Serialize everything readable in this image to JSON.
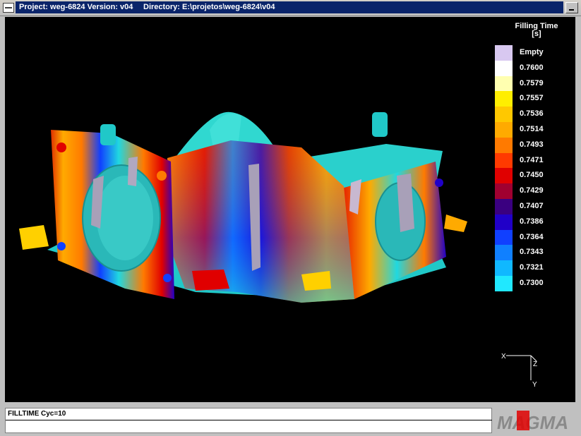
{
  "window": {
    "project_text": "Project: weg-6824  Version: v04",
    "directory_text": "Directory: E:\\projetos\\weg-6824\\v04"
  },
  "legend": {
    "title_line1": "Filling Time",
    "title_line2": "[s]",
    "items": [
      {
        "label": "Empty",
        "color": "#d8c8f0"
      },
      {
        "label": "0.7600",
        "color": "#ffffff"
      },
      {
        "label": "0.7579",
        "color": "#ffffb0"
      },
      {
        "label": "0.7557",
        "color": "#ffee00"
      },
      {
        "label": "0.7536",
        "color": "#ffc800"
      },
      {
        "label": "0.7514",
        "color": "#ffaa00"
      },
      {
        "label": "0.7493",
        "color": "#ff7a00"
      },
      {
        "label": "0.7471",
        "color": "#ff3a00"
      },
      {
        "label": "0.7450",
        "color": "#e00000"
      },
      {
        "label": "0.7429",
        "color": "#a00030"
      },
      {
        "label": "0.7407",
        "color": "#3a0080"
      },
      {
        "label": "0.7386",
        "color": "#2000c8"
      },
      {
        "label": "0.7364",
        "color": "#1040ff"
      },
      {
        "label": "0.7343",
        "color": "#1080ff"
      },
      {
        "label": "0.7321",
        "color": "#10b8ff"
      },
      {
        "label": "0.7300",
        "color": "#20e8ff"
      }
    ]
  },
  "axes": {
    "x": "X",
    "y": "Y",
    "z": "Z"
  },
  "status": {
    "text": "FILLTIME Cyc=10"
  },
  "logo": {
    "text": "MAGMA"
  }
}
